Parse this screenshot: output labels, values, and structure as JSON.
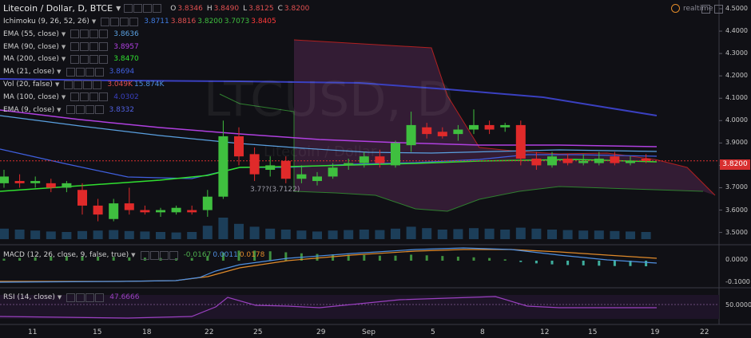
{
  "header": {
    "title": "Litecoin / Dollar, D, BTCE",
    "ohlc": [
      {
        "k": "O",
        "v": "3.8346"
      },
      {
        "k": "H",
        "v": "3.8490"
      },
      {
        "k": "L",
        "v": "3.8125"
      },
      {
        "k": "C",
        "v": "3.8200"
      }
    ],
    "realtime": "realtime"
  },
  "indicators": [
    {
      "name": "Ichimoku (9, 26, 52, 26)",
      "values": [
        {
          "v": "3.8711",
          "color": "#3f7be0"
        },
        {
          "v": "3.8816",
          "color": "#e05050"
        },
        {
          "v": "3.8200",
          "color": "#3fbf3f"
        },
        {
          "v": "3.7073",
          "color": "#3fbf3f"
        },
        {
          "v": "3.8405",
          "color": "#ff3a3a"
        }
      ]
    },
    {
      "name": "EMA (55, close)",
      "values": [
        {
          "v": "3.8636",
          "color": "#5aa0e0"
        }
      ]
    },
    {
      "name": "EMA (90, close)",
      "values": [
        {
          "v": "3.8957",
          "color": "#b040e0"
        }
      ]
    },
    {
      "name": "MA (200, close)",
      "values": [
        {
          "v": "3.8470",
          "color": "#30e030"
        }
      ]
    },
    {
      "name": "MA (21, close)",
      "values": [
        {
          "v": "3.8694",
          "color": "#4060e0"
        }
      ]
    },
    {
      "name": "Vol (20, false)",
      "values": [
        {
          "v": "3.049K",
          "color": "#e05050"
        },
        {
          "v": "15.874K",
          "color": "#4f8fe0"
        }
      ]
    },
    {
      "name": "MA (100, close)",
      "values": [
        {
          "v": "4.0302",
          "color": "#3a40c0"
        }
      ]
    },
    {
      "name": "EMA (9, close)",
      "values": [
        {
          "v": "3.8332",
          "color": "#5060e0"
        }
      ]
    }
  ],
  "macd": {
    "name": "MACD (12, 26, close, 9, false, true)",
    "values": [
      {
        "v": "-0.0167",
        "color": "#4fb04f"
      },
      {
        "v": "0.0011",
        "color": "#4f8fe0"
      },
      {
        "v": "0.0178",
        "color": "#e08a2a"
      }
    ]
  },
  "rsi": {
    "name": "RSI (14, close)",
    "values": [
      {
        "v": "47.6666",
        "color": "#9a40c0"
      }
    ]
  },
  "price_axis": [
    "4.5000",
    "4.4000",
    "4.3000",
    "4.2000",
    "4.1000",
    "4.0000",
    "3.9000",
    "3.8000",
    "3.7000",
    "3.6000",
    "3.5000"
  ],
  "current_price": "3.8200",
  "macd_axis": [
    "0.0000",
    "-0.1000"
  ],
  "rsi_axis": [
    "50.0000"
  ],
  "date_axis": [
    "11",
    "15",
    "18",
    "22",
    "25",
    "29",
    "Sep",
    "5",
    "8",
    "12",
    "15",
    "19",
    "22"
  ],
  "annotation": "3.7122",
  "watermark": {
    "symbol": "LTCUSD, D",
    "name": "Litecoin / Dollar"
  },
  "colors": {
    "up": "#3fbf3f",
    "down": "#e02a2a",
    "cloud": "#3a1f3a",
    "background": "#101015"
  },
  "candles": [
    {
      "o": 3.72,
      "h": 3.78,
      "l": 3.7,
      "c": 3.75
    },
    {
      "o": 3.73,
      "h": 3.76,
      "l": 3.7,
      "c": 3.72
    },
    {
      "o": 3.72,
      "h": 3.75,
      "l": 3.7,
      "c": 3.73
    },
    {
      "o": 3.72,
      "h": 3.74,
      "l": 3.68,
      "c": 3.7
    },
    {
      "o": 3.7,
      "h": 3.73,
      "l": 3.68,
      "c": 3.72
    },
    {
      "o": 3.69,
      "h": 3.72,
      "l": 3.58,
      "c": 3.62
    },
    {
      "o": 3.62,
      "h": 3.65,
      "l": 3.55,
      "c": 3.58
    },
    {
      "o": 3.56,
      "h": 3.65,
      "l": 3.55,
      "c": 3.63
    },
    {
      "o": 3.63,
      "h": 3.7,
      "l": 3.58,
      "c": 3.6
    },
    {
      "o": 3.6,
      "h": 3.62,
      "l": 3.58,
      "c": 3.59
    },
    {
      "o": 3.59,
      "h": 3.61,
      "l": 3.57,
      "c": 3.6
    },
    {
      "o": 3.59,
      "h": 3.62,
      "l": 3.58,
      "c": 3.61
    },
    {
      "o": 3.6,
      "h": 3.62,
      "l": 3.58,
      "c": 3.59
    },
    {
      "o": 3.6,
      "h": 3.69,
      "l": 3.57,
      "c": 3.66
    },
    {
      "o": 3.66,
      "h": 4.0,
      "l": 3.65,
      "c": 3.93
    },
    {
      "o": 3.93,
      "h": 3.97,
      "l": 3.8,
      "c": 3.84
    },
    {
      "o": 3.85,
      "h": 3.88,
      "l": 3.73,
      "c": 3.76
    },
    {
      "o": 3.78,
      "h": 3.84,
      "l": 3.75,
      "c": 3.8
    },
    {
      "o": 3.82,
      "h": 3.84,
      "l": 3.72,
      "c": 3.74
    },
    {
      "o": 3.74,
      "h": 3.8,
      "l": 3.72,
      "c": 3.76
    },
    {
      "o": 3.73,
      "h": 3.77,
      "l": 3.71,
      "c": 3.75
    },
    {
      "o": 3.75,
      "h": 3.81,
      "l": 3.74,
      "c": 3.79
    },
    {
      "o": 3.8,
      "h": 3.83,
      "l": 3.78,
      "c": 3.81
    },
    {
      "o": 3.81,
      "h": 3.86,
      "l": 3.79,
      "c": 3.84
    },
    {
      "o": 3.84,
      "h": 3.87,
      "l": 3.79,
      "c": 3.81
    },
    {
      "o": 3.8,
      "h": 3.91,
      "l": 3.79,
      "c": 3.9
    },
    {
      "o": 3.89,
      "h": 4.04,
      "l": 3.86,
      "c": 3.98
    },
    {
      "o": 3.97,
      "h": 3.99,
      "l": 3.92,
      "c": 3.94
    },
    {
      "o": 3.95,
      "h": 3.97,
      "l": 3.92,
      "c": 3.93
    },
    {
      "o": 3.94,
      "h": 3.98,
      "l": 3.91,
      "c": 3.96
    },
    {
      "o": 3.96,
      "h": 4.05,
      "l": 3.94,
      "c": 3.98
    },
    {
      "o": 3.98,
      "h": 4.0,
      "l": 3.94,
      "c": 3.96
    },
    {
      "o": 3.97,
      "h": 3.99,
      "l": 3.95,
      "c": 3.98
    },
    {
      "o": 3.98,
      "h": 4.0,
      "l": 3.8,
      "c": 3.83
    },
    {
      "o": 3.83,
      "h": 3.86,
      "l": 3.78,
      "c": 3.8
    },
    {
      "o": 3.8,
      "h": 3.86,
      "l": 3.79,
      "c": 3.84
    },
    {
      "o": 3.83,
      "h": 3.85,
      "l": 3.8,
      "c": 3.81
    },
    {
      "o": 3.81,
      "h": 3.85,
      "l": 3.8,
      "c": 3.82
    },
    {
      "o": 3.81,
      "h": 3.86,
      "l": 3.8,
      "c": 3.83
    },
    {
      "o": 3.84,
      "h": 3.86,
      "l": 3.8,
      "c": 3.81
    },
    {
      "o": 3.81,
      "h": 3.84,
      "l": 3.8,
      "c": 3.82
    },
    {
      "o": 3.83,
      "h": 3.85,
      "l": 3.81,
      "c": 3.82
    }
  ],
  "volume": [
    2.2,
    2.0,
    1.8,
    1.6,
    1.5,
    1.7,
    1.8,
    1.9,
    1.7,
    1.6,
    1.5,
    1.4,
    1.5,
    2.8,
    4.5,
    3.2,
    2.6,
    2.2,
    2.0,
    1.8,
    1.6,
    1.8,
    1.9,
    2.0,
    1.9,
    2.2,
    2.6,
    2.3,
    2.0,
    2.1,
    2.3,
    2.2,
    2.0,
    2.4,
    2.2,
    2.0,
    1.9,
    1.8,
    1.8,
    1.7,
    1.6,
    1.5
  ],
  "macd_hist": [
    0.006,
    0.008,
    0.01,
    0.012,
    0.014,
    0.013,
    0.012,
    0.011,
    0.01,
    0.009,
    0.008,
    0.007,
    0.008,
    0.014,
    0.024,
    0.03,
    0.03,
    0.028,
    0.025,
    0.022,
    0.02,
    0.019,
    0.018,
    0.017,
    0.015,
    0.015,
    0.018,
    0.016,
    0.014,
    0.012,
    0.01,
    0.008,
    0.004,
    -0.004,
    -0.008,
    -0.011,
    -0.013,
    -0.014,
    -0.015,
    -0.016,
    -0.016,
    -0.0167
  ]
}
